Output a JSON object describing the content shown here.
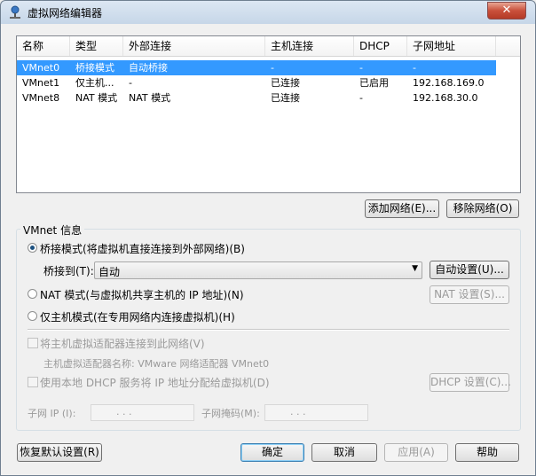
{
  "window": {
    "title": "虚拟网络编辑器",
    "close_label": "✕"
  },
  "table": {
    "columns": [
      "名称",
      "类型",
      "外部连接",
      "主机连接",
      "DHCP",
      "子网地址"
    ],
    "rows": [
      [
        "VMnet0",
        "桥接模式",
        "自动桥接",
        "-",
        "-",
        "-"
      ],
      [
        "VMnet1",
        "仅主机...",
        "-",
        "已连接",
        "已启用",
        "192.168.169.0"
      ],
      [
        "VMnet8",
        "NAT 模式",
        "NAT 模式",
        "已连接",
        "-",
        "192.168.30.0"
      ]
    ],
    "selected_row": 0
  },
  "buttons": {
    "add_network": "添加网络(E)...",
    "remove_network": "移除网络(O)",
    "auto_settings": "自动设置(U)...",
    "nat_settings": "NAT 设置(S)...",
    "dhcp_settings": "DHCP 设置(C)...",
    "restore_defaults": "恢复默认设置(R)",
    "ok": "确定",
    "cancel": "取消",
    "apply": "应用(A)",
    "help": "帮助"
  },
  "vmnet_info": {
    "group_title": "VMnet 信息",
    "bridged_label": "桥接模式(将虚拟机直接连接到外部网络)(B)",
    "bridged_to_label": "桥接到(T):",
    "bridged_to_value": "自动",
    "nat_label": "NAT 模式(与虚拟机共享主机的 IP 地址)(N)",
    "host_only_label": "仅主机模式(在专用网络内连接虚拟机)(H)",
    "selected_mode": "bridged",
    "connect_adapter_label": "将主机虚拟适配器连接到此网络(V)",
    "adapter_name_label": "主机虚拟适配器名称: VMware 网络适配器 VMnet0",
    "use_dhcp_label": "使用本地 DHCP 服务将 IP 地址分配给虚拟机(D)",
    "subnet_ip_label": "子网 IP (I):",
    "subnet_mask_label": "子网掩码(M):",
    "ip_dots": ".      .      .",
    "mask_dots": ".      .      ."
  }
}
